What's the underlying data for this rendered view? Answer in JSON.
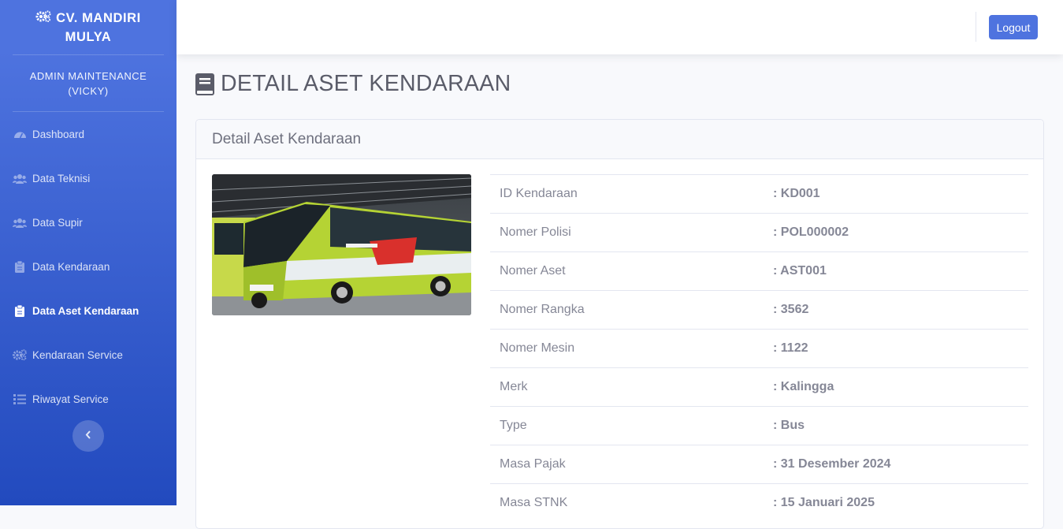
{
  "brand": {
    "name": "CV. MANDIRI MULYA",
    "icon": "cogs-icon"
  },
  "admin": {
    "label": "ADMIN MAINTENANCE (VICKY)"
  },
  "sidebar": {
    "items": [
      {
        "label": "Dashboard",
        "icon": "tachometer-icon",
        "active": false
      },
      {
        "label": "Data Teknisi",
        "icon": "users-icon",
        "active": false
      },
      {
        "label": "Data Supir",
        "icon": "users-icon",
        "active": false
      },
      {
        "label": "Data Kendaraan",
        "icon": "clipboard-icon",
        "active": false
      },
      {
        "label": "Data Aset Kendaraan",
        "icon": "clipboard-icon",
        "active": true
      },
      {
        "label": "Kendaraan Service",
        "icon": "cogs-icon",
        "active": false
      },
      {
        "label": "Riwayat Service",
        "icon": "list-icon",
        "active": false
      }
    ],
    "toggle_icon": "chevron-left-icon"
  },
  "topbar": {
    "logout_label": "Logout"
  },
  "page": {
    "title": "DETAIL ASET KENDARAAN",
    "title_icon": "book-icon"
  },
  "card": {
    "header": "Detail Aset Kendaraan",
    "rows": [
      {
        "label": "ID Kendaraan",
        "value": ": KD001"
      },
      {
        "label": "Nomer Polisi",
        "value": ": POL000002"
      },
      {
        "label": "Nomer Aset",
        "value": ": AST001"
      },
      {
        "label": "Nomer Rangka",
        "value": ": 3562"
      },
      {
        "label": "Nomer Mesin",
        "value": ": 1122"
      },
      {
        "label": "Merk",
        "value": ": Kalingga"
      },
      {
        "label": "Type",
        "value": ": Bus"
      },
      {
        "label": "Masa Pajak",
        "value": ": 31 Desember 2024"
      },
      {
        "label": "Masa STNK",
        "value": ": 15 Januari 2025"
      }
    ]
  },
  "colors": {
    "primary": "#4e73df",
    "sidebar_dark": "#224abe",
    "bus_green": "#b5d334"
  }
}
